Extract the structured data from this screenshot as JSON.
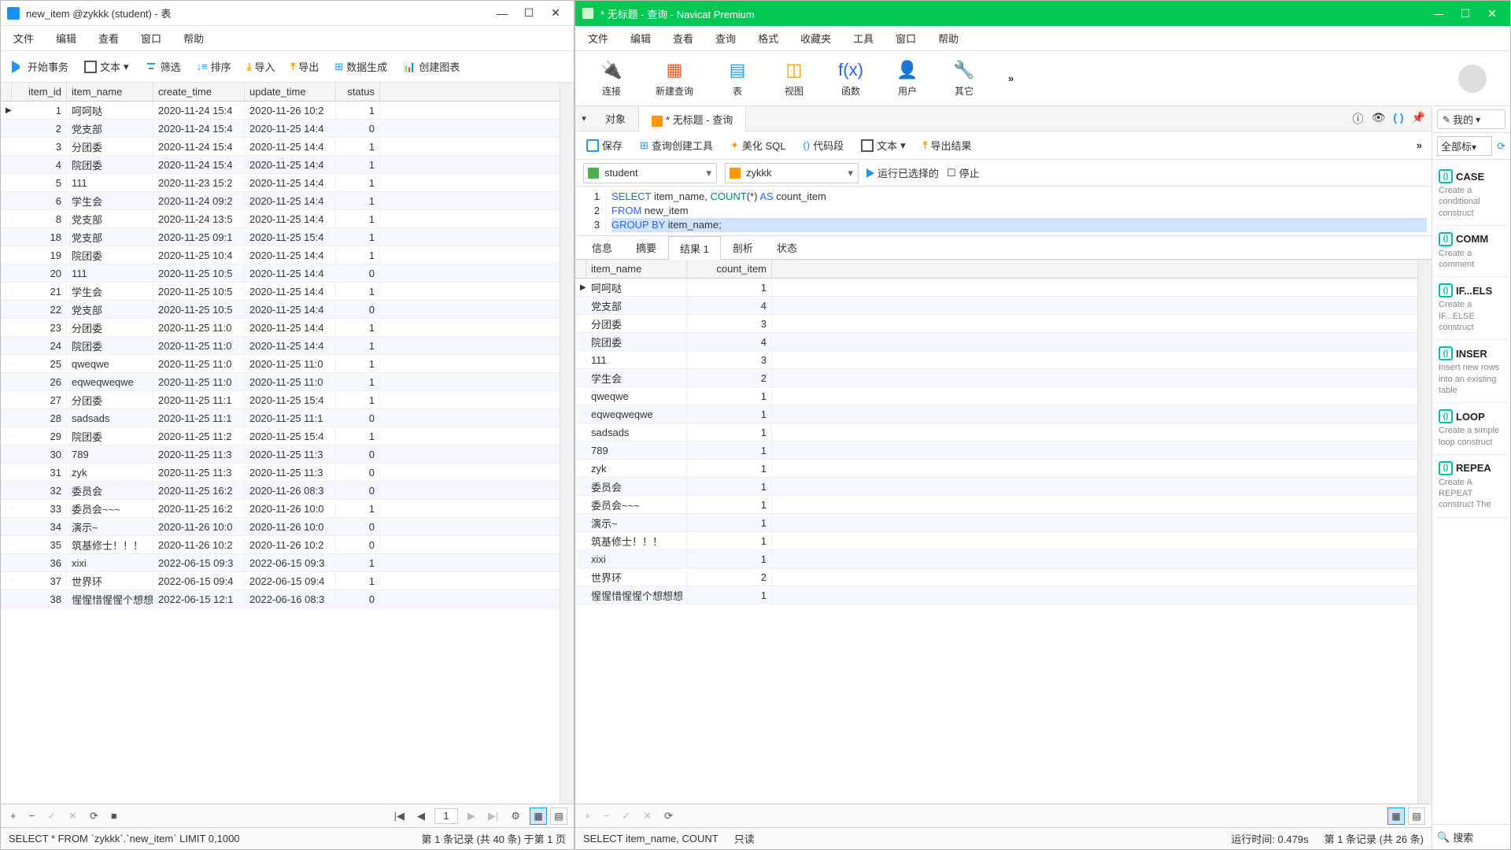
{
  "left": {
    "title": "new_item @zykkk (student) - 表",
    "menu": [
      "文件",
      "编辑",
      "查看",
      "窗口",
      "帮助"
    ],
    "toolbar": {
      "begin": "开始事务",
      "text": "文本",
      "filter": "筛选",
      "sort": "排序",
      "import": "导入",
      "export": "导出",
      "gen": "数据生成",
      "chart": "创建图表"
    },
    "columns": [
      "item_id",
      "item_name",
      "create_time",
      "update_time",
      "status"
    ],
    "rows": [
      {
        "id": "1",
        "name": "呵呵哒",
        "ct": "2020-11-24 15:4",
        "ut": "2020-11-26 10:2",
        "st": "1",
        "mark": "▶"
      },
      {
        "id": "2",
        "name": "党支部",
        "ct": "2020-11-24 15:4",
        "ut": "2020-11-25 14:4",
        "st": "0"
      },
      {
        "id": "3",
        "name": "分团委",
        "ct": "2020-11-24 15:4",
        "ut": "2020-11-25 14:4",
        "st": "1"
      },
      {
        "id": "4",
        "name": "院团委",
        "ct": "2020-11-24 15:4",
        "ut": "2020-11-25 14:4",
        "st": "1"
      },
      {
        "id": "5",
        "name": "111",
        "ct": "2020-11-23 15:2",
        "ut": "2020-11-25 14:4",
        "st": "1"
      },
      {
        "id": "6",
        "name": "学生会",
        "ct": "2020-11-24 09:2",
        "ut": "2020-11-25 14:4",
        "st": "1"
      },
      {
        "id": "8",
        "name": "党支部",
        "ct": "2020-11-24 13:5",
        "ut": "2020-11-25 14:4",
        "st": "1"
      },
      {
        "id": "18",
        "name": "党支部",
        "ct": "2020-11-25 09:1",
        "ut": "2020-11-25 15:4",
        "st": "1"
      },
      {
        "id": "19",
        "name": "院团委",
        "ct": "2020-11-25 10:4",
        "ut": "2020-11-25 14:4",
        "st": "1"
      },
      {
        "id": "20",
        "name": "111",
        "ct": "2020-11-25 10:5",
        "ut": "2020-11-25 14:4",
        "st": "0"
      },
      {
        "id": "21",
        "name": "学生会",
        "ct": "2020-11-25 10:5",
        "ut": "2020-11-25 14:4",
        "st": "1"
      },
      {
        "id": "22",
        "name": "党支部",
        "ct": "2020-11-25 10:5",
        "ut": "2020-11-25 14:4",
        "st": "0"
      },
      {
        "id": "23",
        "name": "分团委",
        "ct": "2020-11-25 11:0",
        "ut": "2020-11-25 14:4",
        "st": "1"
      },
      {
        "id": "24",
        "name": "院团委",
        "ct": "2020-11-25 11:0",
        "ut": "2020-11-25 14:4",
        "st": "1"
      },
      {
        "id": "25",
        "name": "qweqwe",
        "ct": "2020-11-25 11:0",
        "ut": "2020-11-25 11:0",
        "st": "1"
      },
      {
        "id": "26",
        "name": "eqweqweqwe",
        "ct": "2020-11-25 11:0",
        "ut": "2020-11-25 11:0",
        "st": "1"
      },
      {
        "id": "27",
        "name": "分团委",
        "ct": "2020-11-25 11:1",
        "ut": "2020-11-25 15:4",
        "st": "1"
      },
      {
        "id": "28",
        "name": "sadsads",
        "ct": "2020-11-25 11:1",
        "ut": "2020-11-25 11:1",
        "st": "0"
      },
      {
        "id": "29",
        "name": "院团委",
        "ct": "2020-11-25 11:2",
        "ut": "2020-11-25 15:4",
        "st": "1"
      },
      {
        "id": "30",
        "name": "789",
        "ct": "2020-11-25 11:3",
        "ut": "2020-11-25 11:3",
        "st": "0"
      },
      {
        "id": "31",
        "name": "zyk",
        "ct": "2020-11-25 11:3",
        "ut": "2020-11-25 11:3",
        "st": "0"
      },
      {
        "id": "32",
        "name": "委员会",
        "ct": "2020-11-25 16:2",
        "ut": "2020-11-26 08:3",
        "st": "0"
      },
      {
        "id": "33",
        "name": "委员会~~~",
        "ct": "2020-11-25 16:2",
        "ut": "2020-11-26 10:0",
        "st": "1"
      },
      {
        "id": "34",
        "name": "演示~",
        "ct": "2020-11-26 10:0",
        "ut": "2020-11-26 10:0",
        "st": "0"
      },
      {
        "id": "35",
        "name": "筑基修士！！！",
        "ct": "2020-11-26 10:2",
        "ut": "2020-11-26 10:2",
        "st": "0"
      },
      {
        "id": "36",
        "name": "xixi",
        "ct": "2022-06-15 09:3",
        "ut": "2022-06-15 09:3",
        "st": "1"
      },
      {
        "id": "37",
        "name": "世界环",
        "ct": "2022-06-15 09:4",
        "ut": "2022-06-15 09:4",
        "st": "1"
      },
      {
        "id": "38",
        "name": "惺惺惜惺惺个想想",
        "ct": "2022-06-15 12:1",
        "ut": "2022-06-16 08:3",
        "st": "0"
      }
    ],
    "nav": {
      "page": "1"
    },
    "status": {
      "query": "SELECT * FROM `zykkk`.`new_item` LIMIT 0,1000",
      "records": "第 1 条记录 (共 40 条) 于第 1 页"
    }
  },
  "right": {
    "title": "* 无标题 - 查询 - Navicat Premium",
    "menu": [
      "文件",
      "编辑",
      "查看",
      "查询",
      "格式",
      "收藏夹",
      "工具",
      "窗口",
      "帮助"
    ],
    "bigbtns": [
      {
        "icon": "🔌",
        "label": "连接",
        "color": "#4caf50"
      },
      {
        "icon": "▦",
        "label": "新建查询",
        "color": "#ff5722"
      },
      {
        "icon": "▤",
        "label": "表",
        "color": "#2196f3"
      },
      {
        "icon": "◫",
        "label": "视图",
        "color": "#ff9800"
      },
      {
        "icon": "f(x)",
        "label": "函数",
        "color": "#2962ff"
      },
      {
        "icon": "👤",
        "label": "用户",
        "color": "#ff9800"
      },
      {
        "icon": "🔧",
        "label": "其它",
        "color": "#607d8b"
      }
    ],
    "tabs": {
      "obj": "对象",
      "query": "* 无标题 - 查询"
    },
    "subtb": {
      "save": "保存",
      "builder": "查询创建工具",
      "beautify": "美化 SQL",
      "snippet": "代码段",
      "text": "文本",
      "export": "导出结果"
    },
    "db": "student",
    "schema": "zykkk",
    "run": "运行已选择的",
    "stop": "停止",
    "sql": [
      {
        "n": "1",
        "t": [
          {
            "c": "tok-kw",
            "v": "SELECT"
          },
          {
            "v": " item_name, "
          },
          {
            "c": "tok-fn",
            "v": "COUNT"
          },
          {
            "v": "(*) "
          },
          {
            "c": "tok-kw",
            "v": "AS"
          },
          {
            "v": " count_item"
          }
        ]
      },
      {
        "n": "2",
        "t": [
          {
            "c": "tok-kw",
            "v": "FROM"
          },
          {
            "v": " new_item"
          }
        ]
      },
      {
        "n": "3",
        "t": [
          {
            "c": "tok-kw",
            "v": "GROUP BY"
          },
          {
            "v": " item_name;"
          }
        ],
        "sel": true
      }
    ],
    "restabs": [
      "信息",
      "摘要",
      "结果 1",
      "剖析",
      "状态"
    ],
    "restab_active": 2,
    "rescols": [
      "item_name",
      "count_item"
    ],
    "resrows": [
      {
        "n": "呵呵哒",
        "c": "1",
        "mark": "▶"
      },
      {
        "n": "党支部",
        "c": "4"
      },
      {
        "n": "分团委",
        "c": "3"
      },
      {
        "n": "院团委",
        "c": "4"
      },
      {
        "n": "111",
        "c": "3"
      },
      {
        "n": "学生会",
        "c": "2"
      },
      {
        "n": "qweqwe",
        "c": "1"
      },
      {
        "n": "eqweqweqwe",
        "c": "1"
      },
      {
        "n": "sadsads",
        "c": "1"
      },
      {
        "n": "789",
        "c": "1"
      },
      {
        "n": "zyk",
        "c": "1"
      },
      {
        "n": "委员会",
        "c": "1"
      },
      {
        "n": "委员会~~~",
        "c": "1"
      },
      {
        "n": "演示~",
        "c": "1"
      },
      {
        "n": "筑基修士！！！",
        "c": "1"
      },
      {
        "n": "xixi",
        "c": "1"
      },
      {
        "n": "世界环",
        "c": "2"
      },
      {
        "n": "惺惺惜惺惺个想想想",
        "c": "1"
      }
    ],
    "side": {
      "magic": "我的",
      "tags": "全部标",
      "snips": [
        {
          "t": "CASE",
          "d": "Create a conditional construct"
        },
        {
          "t": "COMM",
          "d": "Create a comment"
        },
        {
          "t": "IF...ELS",
          "d": "Create a IF...ELSE construct"
        },
        {
          "t": "INSER",
          "d": "Insert new rows into an existing table"
        },
        {
          "t": "LOOP",
          "d": "Create a simple loop construct"
        },
        {
          "t": "REPEA",
          "d": "Create A REPEAT construct The"
        }
      ],
      "search": "搜索"
    },
    "status": {
      "query": "SELECT item_name, COUNT",
      "ro": "只读",
      "time": "运行时间: 0.479s",
      "records": "第 1 条记录  (共 26 条)"
    }
  }
}
